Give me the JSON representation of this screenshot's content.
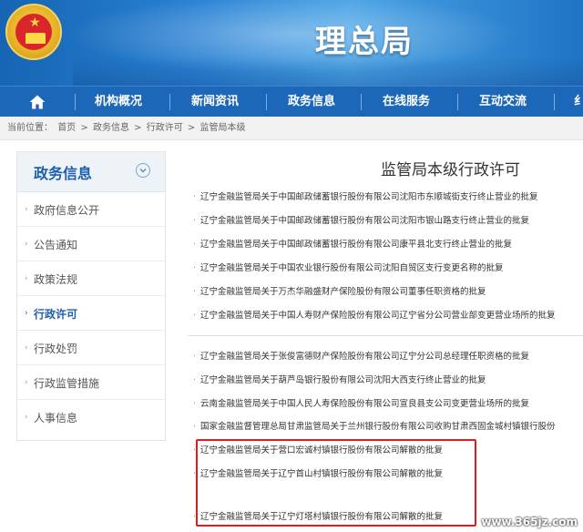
{
  "header": {
    "site_title": "理总局"
  },
  "nav": {
    "home_icon": "home-icon",
    "items": [
      "机构概况",
      "新闻资讯",
      "政务信息",
      "在线服务",
      "互动交流",
      "纟"
    ]
  },
  "breadcrumb": {
    "prefix": "当前位置：",
    "items": [
      "首页",
      "政务信息",
      "行政许可",
      "监管局本级"
    ],
    "separator": ">"
  },
  "sidebar": {
    "title": "政务信息",
    "items": [
      {
        "label": "政府信息公开",
        "active": false
      },
      {
        "label": "公告通知",
        "active": false
      },
      {
        "label": "政策法规",
        "active": false
      },
      {
        "label": "行政许可",
        "active": true
      },
      {
        "label": "行政处罚",
        "active": false
      },
      {
        "label": "行政监管措施",
        "active": false
      },
      {
        "label": "人事信息",
        "active": false
      }
    ]
  },
  "main": {
    "title": "监管局本级行政许可",
    "articles": [
      "辽宁金融监管局关于中国邮政储蓄银行股份有限公司沈阳市东顺城街支行终止营业的批复",
      "辽宁金融监管局关于中国邮政储蓄银行股份有限公司沈阳市银山路支行终止营业的批复",
      "辽宁金融监管局关于中国邮政储蓄银行股份有限公司康平县北支行终止营业的批复",
      "辽宁金融监管局关于中国农业银行股份有限公司沈阳自贸区支行变更名称的批复",
      "辽宁金融监管局关于万杰华融盛财产保险股份有限公司董事任职资格的批复",
      "辽宁金融监管局关于中国人寿财产保险股份有限公司辽宁省分公司营业部变更营业场所的批复",
      "辽宁金融监管局关于张俊富德财产保险股份有限公司辽宁分公司总经理任职资格的批复",
      "辽宁金融监管局关于葫芦岛银行股份有限公司沈阳大西支行终止营业的批复",
      "云南金融监管局关于中国人民人寿保险股份有限公司宣良县支公司变更营业场所的批复",
      "国家金融监督管理总局甘肃监管局关于兰州银行股份有限公司收购甘肃西固金城村镇银行股份",
      "辽宁金融监管局关于营口宏诚村镇银行股份有限公司解散的批复",
      "辽宁金融监管局关于辽宁首山村镇银行股份有限公司解散的批复",
      "辽宁金融监管局关于辽宁灯塔村镇银行股份有限公司解散的批复"
    ]
  },
  "watermark": "www.365jz.com"
}
